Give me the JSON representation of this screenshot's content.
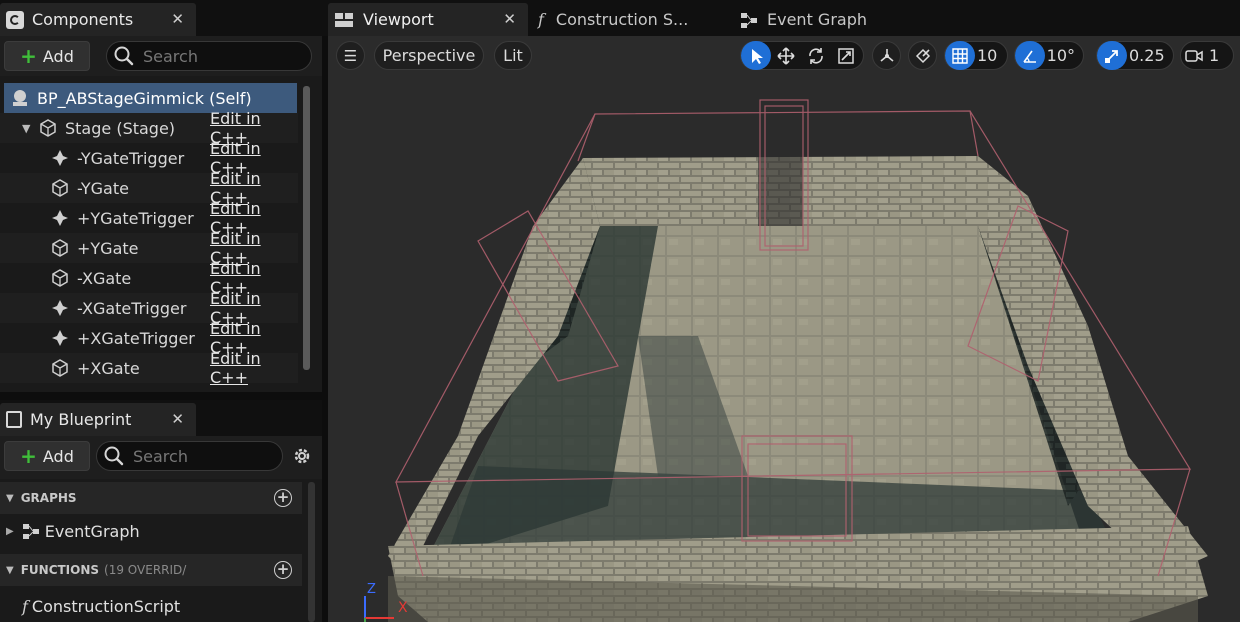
{
  "components_panel": {
    "tab_title": "Components",
    "add_label": "Add",
    "search_placeholder": "Search",
    "tree": [
      {
        "label": "BP_ABStageGimmick (Self)",
        "icon": "self-actor-icon",
        "edit": ""
      },
      {
        "label": "Stage (Stage)",
        "icon": "static-mesh-icon",
        "edit": "Edit in C++"
      },
      {
        "label": "-YGateTrigger",
        "icon": "trigger-box-icon",
        "edit": "Edit in C++"
      },
      {
        "label": "-YGate",
        "icon": "static-mesh-icon",
        "edit": "Edit in C++"
      },
      {
        "label": "+YGateTrigger",
        "icon": "trigger-box-icon",
        "edit": "Edit in C++"
      },
      {
        "label": "+YGate",
        "icon": "static-mesh-icon",
        "edit": "Edit in C++"
      },
      {
        "label": "-XGate",
        "icon": "static-mesh-icon",
        "edit": "Edit in C++"
      },
      {
        "label": "-XGateTrigger",
        "icon": "trigger-box-icon",
        "edit": "Edit in C++"
      },
      {
        "label": "+XGateTrigger",
        "icon": "trigger-box-icon",
        "edit": "Edit in C++"
      },
      {
        "label": "+XGate",
        "icon": "static-mesh-icon",
        "edit": "Edit in C++"
      }
    ]
  },
  "blueprint_panel": {
    "tab_title": "My Blueprint",
    "add_label": "Add",
    "search_placeholder": "Search",
    "graphs_header": "GRAPHS",
    "graphs_items": [
      "EventGraph"
    ],
    "functions_header": "FUNCTIONS",
    "functions_sub": "(19 OVERRID/",
    "functions_items": [
      "ConstructionScript"
    ]
  },
  "editor_tabs": [
    {
      "label": "Viewport",
      "icon": "viewport-icon",
      "active": true
    },
    {
      "label": "Construction S...",
      "icon": "function-icon",
      "active": false
    },
    {
      "label": "Event Graph",
      "icon": "event-graph-icon",
      "active": false
    }
  ],
  "viewport_toolbar": {
    "perspective": "Perspective",
    "lit": "Lit",
    "grid_snap": "10",
    "rotation_snap": "10°",
    "scale_snap": "0.25",
    "camera_speed": "1"
  },
  "axis_gizmo": {
    "z": "Z",
    "x": "X"
  },
  "colors": {
    "accent": "#1f6fd6",
    "selection": "#3d5a7d",
    "add_plus": "#3fbf3a",
    "trigger_box": "#b0606e"
  }
}
